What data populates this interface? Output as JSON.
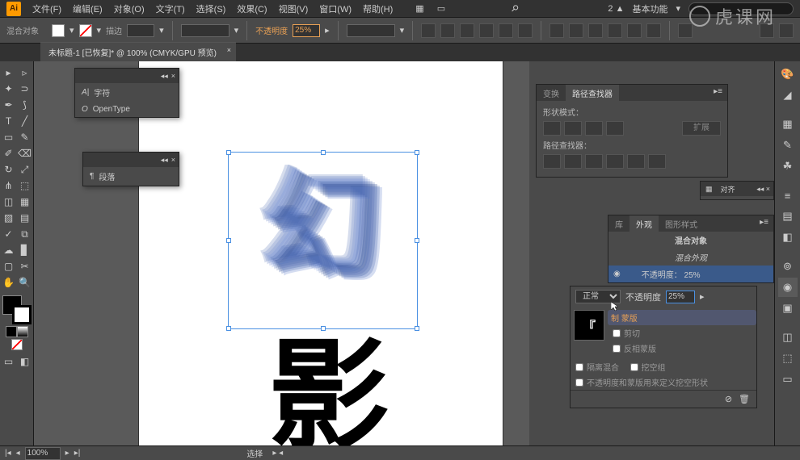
{
  "title_label": "混合对象",
  "menus": [
    "文件(F)",
    "编辑(E)",
    "对象(O)",
    "文字(T)",
    "选择(S)",
    "效果(C)",
    "视图(V)",
    "窗口(W)",
    "帮助(H)"
  ],
  "menubar_right": {
    "notif": "2",
    "workspace": "基本功能"
  },
  "options": {
    "stroke_label": "描边",
    "opacity_label": "不透明度",
    "opacity_value": "25%"
  },
  "doc_tab": "未标题-1 [已恢复]* @ 100% (CMYK/GPU 预览)",
  "floating": {
    "char_panel": {
      "row1": "字符",
      "row2": "OpenType"
    },
    "para_panel": {
      "row1": "段落"
    }
  },
  "panels": {
    "pathfinder": {
      "tabs": [
        "变换",
        "路径查找器"
      ],
      "label1": "形状模式：",
      "label2": "路径查找器：",
      "expand": "扩展"
    },
    "align": {
      "label": "对齐"
    },
    "appearance": {
      "tabs": [
        "库",
        "外观",
        "图形样式"
      ],
      "title": "混合对象",
      "sub": "混合外观",
      "opacity_row": "不透明度：",
      "opacity_val": "25%"
    }
  },
  "transparency": {
    "mode": "正常",
    "opacity_label": "不透明度",
    "opacity_value": "25%",
    "mask_btn": "制 蒙版",
    "clip": "剪切",
    "invert": "反相蒙版",
    "chk1": "隔离混合",
    "chk2": "挖空组",
    "chk3": "不透明度和蒙版用来定义挖空形状"
  },
  "statusbar": {
    "zoom": "100%",
    "tool_hint": "选择"
  },
  "watermark": "虎课网",
  "artglyph": "幻",
  "bottomglyph": "影"
}
